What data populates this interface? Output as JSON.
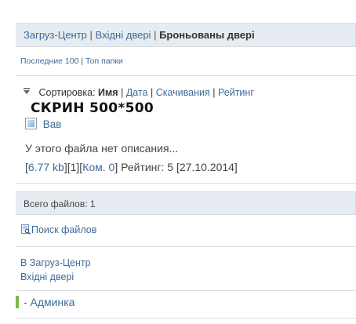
{
  "breadcrumb": {
    "items": [
      "Загруз-Центр",
      "Вхідні двері"
    ],
    "current": "Броньованы двері",
    "separator": "|"
  },
  "topnav": {
    "last": "Последние 100",
    "top": "Топ папки",
    "separator": "|"
  },
  "sort": {
    "label": "Сортировка:",
    "active": "Имя",
    "options": [
      "Дата",
      "Скачивания",
      "Рейтинг"
    ],
    "separator": "|"
  },
  "watermark": "СКРИН 500*500",
  "file": {
    "name": "Вав",
    "description": "У этого файла нет описания...",
    "size": "6.77 kb",
    "count": "[1]",
    "comments": "Ком. 0",
    "rating": "Рейтинг: 5",
    "date": "[27.10.2014]"
  },
  "total": "Всего файлов: 1",
  "search": "Поиск файлов",
  "back": [
    "В Загруз-Центр",
    "Вхідні двері"
  ],
  "admin": "- Админка",
  "colors": {
    "link": "#3f6b99",
    "bar_bg": "#e6ecf1",
    "accent": "#7fb84a"
  }
}
